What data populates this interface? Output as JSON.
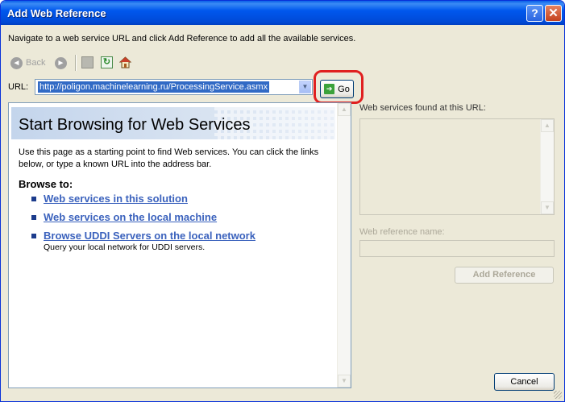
{
  "window": {
    "title": "Add Web Reference",
    "help_label": "?",
    "close_label": "✕"
  },
  "instructions": "Navigate to a web service URL and click Add Reference to add all the available services.",
  "toolbar": {
    "back_label": "Back",
    "back_glyph": "◄",
    "forward_glyph": "►",
    "refresh_glyph": "↻",
    "icons": [
      "back-icon",
      "forward-icon",
      "stop-icon",
      "refresh-icon",
      "home-icon"
    ]
  },
  "url": {
    "label": "URL:",
    "value": "http://poligon.machinelearning.ru/ProcessingService.asmx",
    "dropdown_glyph": "▼",
    "go_label": "Go",
    "go_glyph": "➔"
  },
  "browser": {
    "banner_title": "Start Browsing for Web Services",
    "intro": "Use this page as a starting point to find Web services. You can click the links below, or type a known URL into the address bar.",
    "browse_heading": "Browse to:",
    "links": [
      {
        "label": "Web services in this solution"
      },
      {
        "label": "Web services on the local machine"
      },
      {
        "label": "Browse UDDI Servers on the local network",
        "description": "Query your local network for UDDI servers."
      }
    ]
  },
  "scroll_glyphs": {
    "up": "▲",
    "down": "▼"
  },
  "side": {
    "found_label": "Web services found at this URL:",
    "ref_name_label": "Web reference name:",
    "ref_name_value": "",
    "add_reference_label": "Add Reference"
  },
  "cancel_label": "Cancel",
  "colors": {
    "titlebar": "#0054E3",
    "dialog_bg": "#ECE9D8",
    "link": "#3B62BD",
    "selection": "#316AC5",
    "highlight_ring": "#E02020"
  }
}
